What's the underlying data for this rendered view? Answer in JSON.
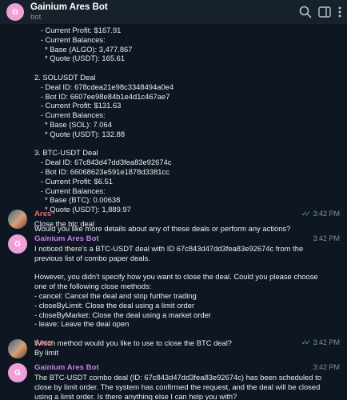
{
  "header": {
    "avatar_letter": "G",
    "title": "Gainium Ares Bot",
    "subtitle": "bot"
  },
  "feed": {
    "top_block": "   - Current Profit: $167.91\n   - Current Balances:\n     * Base (ALGO): 3,477.867\n     * Quote (USDT): 165.61\n\n2. SOLUSDT Deal\n   - Deal ID: 678cdea21e98c3348494a0e4\n   - Bot ID: 6607ee98e84b1e4d1c467ae7\n   - Current Profit: $131.63\n   - Current Balances:\n     * Base (SOL): 7.064\n     * Quote (USDT): 132.88\n\n3. BTC-USDT Deal\n   - Deal ID: 67c843d47dd3fea83e92674c\n   - Bot ID: 66068623e591e1878d3381cc\n   - Current Profit: $6.51\n   - Current Balances:\n     * Base (BTC): 0.00638\n     * Quote (USDT): 1,889.97\n\nWould you like more details about any of these deals or perform any actions?",
    "messages": [
      {
        "sender": "Ares",
        "avatar_letter": "",
        "text": "Close the btc deal",
        "time": "3:42 PM",
        "ticks": "✓✓"
      },
      {
        "sender": "Gainium Ares Bot",
        "avatar_letter": "G",
        "text": "I noticed there's a BTC-USDT deal with ID 67c843d47dd3fea83e92674c from the\nprevious list of combo paper deals.\n\nHowever, you didn't specify how you want to close the deal. Could you please choose\none of the following close methods:\n- cancel: Cancel the deal and stop further trading\n- closeByLimit: Close the deal using a limit order\n- closeByMarket: Close the deal using a market order\n- leave: Leave the deal open\n\nWhich method would you like to use to close the BTC deal?",
        "time": "3:42 PM"
      },
      {
        "sender": "Ares",
        "avatar_letter": "",
        "text": "By limit",
        "time": "3:42 PM",
        "ticks": "✓✓"
      },
      {
        "sender": "Gainium Ares Bot",
        "avatar_letter": "G",
        "text": "The BTC-USDT combo deal (ID: 67c843d47dd3fea83e92674c) has been scheduled to\nclose by limit order. The system has confirmed the request, and the deal will be closed\nusing a limit order. Is there anything else I can help you with?",
        "time": "3:42 PM"
      }
    ]
  },
  "colors": {
    "bot_name": "#c47fe8",
    "user_name": "#e36b6b",
    "background": "#0e1621",
    "header": "#17212b"
  },
  "icons": [
    "search-icon",
    "sidebar-toggle-icon",
    "more-options-icon"
  ]
}
